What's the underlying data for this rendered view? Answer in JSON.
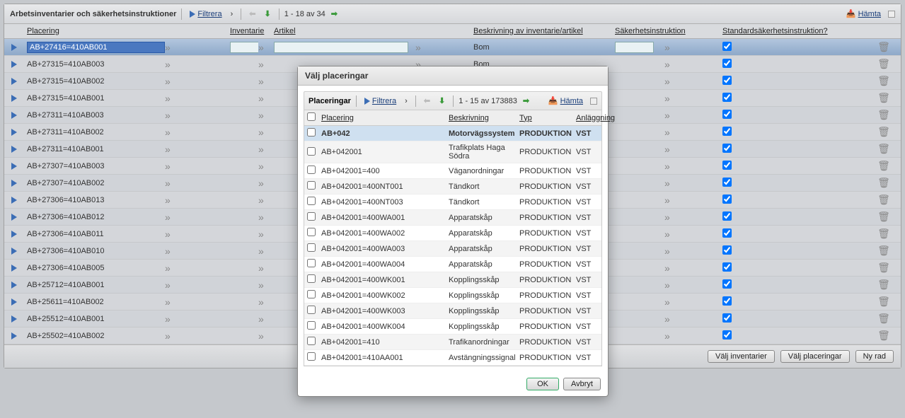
{
  "main": {
    "title": "Arbetsinventarier och säkerhetsinstruktioner",
    "filter_label": "Filtrera",
    "paging": "1 - 18 av 34",
    "download_label": "Hämta",
    "columns": {
      "placering": "Placering",
      "inventarie": "Inventarie",
      "artikel": "Artikel",
      "beskrivning": "Beskrivning av inventarie/artikel",
      "safety": "Säkerhetsinstruktion",
      "std_safety": "Standardsäkerhetsinstruktion?"
    },
    "rows": [
      {
        "placering": "AB+27416=410AB001",
        "beskrivning": "Bom",
        "std": true,
        "selected": true
      },
      {
        "placering": "AB+27315=410AB003",
        "beskrivning": "Bom",
        "std": true
      },
      {
        "placering": "AB+27315=410AB002",
        "beskrivning": "",
        "std": true
      },
      {
        "placering": "AB+27315=410AB001",
        "beskrivning": "",
        "std": true
      },
      {
        "placering": "AB+27311=410AB003",
        "beskrivning": "",
        "std": true
      },
      {
        "placering": "AB+27311=410AB002",
        "beskrivning": "",
        "std": true
      },
      {
        "placering": "AB+27311=410AB001",
        "beskrivning": "",
        "std": true
      },
      {
        "placering": "AB+27307=410AB003",
        "beskrivning": "",
        "std": true
      },
      {
        "placering": "AB+27307=410AB002",
        "beskrivning": "",
        "std": true
      },
      {
        "placering": "AB+27306=410AB013",
        "beskrivning": "",
        "std": true
      },
      {
        "placering": "AB+27306=410AB012",
        "beskrivning": "",
        "std": true
      },
      {
        "placering": "AB+27306=410AB011",
        "beskrivning": "",
        "std": true
      },
      {
        "placering": "AB+27306=410AB010",
        "beskrivning": "",
        "std": true
      },
      {
        "placering": "AB+27306=410AB005",
        "beskrivning": "",
        "std": true
      },
      {
        "placering": "AB+25712=410AB001",
        "beskrivning": "",
        "std": true
      },
      {
        "placering": "AB+25611=410AB002",
        "beskrivning": "",
        "std": true
      },
      {
        "placering": "AB+25512=410AB001",
        "beskrivning": "",
        "std": true
      },
      {
        "placering": "AB+25502=410AB002",
        "beskrivning": "",
        "std": true
      }
    ],
    "footer": {
      "valj_inventarier": "Välj inventarier",
      "valj_placeringar": "Välj placeringar",
      "ny_rad": "Ny rad"
    }
  },
  "dialog": {
    "title": "Välj placeringar",
    "toolbar": {
      "label": "Placeringar",
      "filter": "Filtrera",
      "paging": "1 - 15 av 173883",
      "download": "Hämta"
    },
    "columns": {
      "placering": "Placering",
      "beskrivning": "Beskrivning",
      "typ": "Typ",
      "anlaggning": "Anläggning"
    },
    "rows": [
      {
        "placering": "AB+042",
        "beskrivning": "Motorvägssystem",
        "typ": "PRODUKTION",
        "anl": "VST",
        "selected": true
      },
      {
        "placering": "AB+042001",
        "beskrivning": "Trafikplats Haga Södra",
        "typ": "PRODUKTION",
        "anl": "VST"
      },
      {
        "placering": "AB+042001=400",
        "beskrivning": "Väganordningar",
        "typ": "PRODUKTION",
        "anl": "VST"
      },
      {
        "placering": "AB+042001=400NT001",
        "beskrivning": "Tändkort",
        "typ": "PRODUKTION",
        "anl": "VST"
      },
      {
        "placering": "AB+042001=400NT003",
        "beskrivning": "Tändkort",
        "typ": "PRODUKTION",
        "anl": "VST"
      },
      {
        "placering": "AB+042001=400WA001",
        "beskrivning": "Apparatskåp",
        "typ": "PRODUKTION",
        "anl": "VST"
      },
      {
        "placering": "AB+042001=400WA002",
        "beskrivning": "Apparatskåp",
        "typ": "PRODUKTION",
        "anl": "VST"
      },
      {
        "placering": "AB+042001=400WA003",
        "beskrivning": "Apparatskåp",
        "typ": "PRODUKTION",
        "anl": "VST"
      },
      {
        "placering": "AB+042001=400WA004",
        "beskrivning": "Apparatskåp",
        "typ": "PRODUKTION",
        "anl": "VST"
      },
      {
        "placering": "AB+042001=400WK001",
        "beskrivning": "Kopplingsskåp",
        "typ": "PRODUKTION",
        "anl": "VST"
      },
      {
        "placering": "AB+042001=400WK002",
        "beskrivning": "Kopplingsskåp",
        "typ": "PRODUKTION",
        "anl": "VST"
      },
      {
        "placering": "AB+042001=400WK003",
        "beskrivning": "Kopplingsskåp",
        "typ": "PRODUKTION",
        "anl": "VST"
      },
      {
        "placering": "AB+042001=400WK004",
        "beskrivning": "Kopplingsskåp",
        "typ": "PRODUKTION",
        "anl": "VST"
      },
      {
        "placering": "AB+042001=410",
        "beskrivning": "Trafikanordningar",
        "typ": "PRODUKTION",
        "anl": "VST"
      },
      {
        "placering": "AB+042001=410AA001",
        "beskrivning": "Avstängningssignal",
        "typ": "PRODUKTION",
        "anl": "VST"
      }
    ],
    "buttons": {
      "ok": "OK",
      "cancel": "Avbryt"
    }
  }
}
